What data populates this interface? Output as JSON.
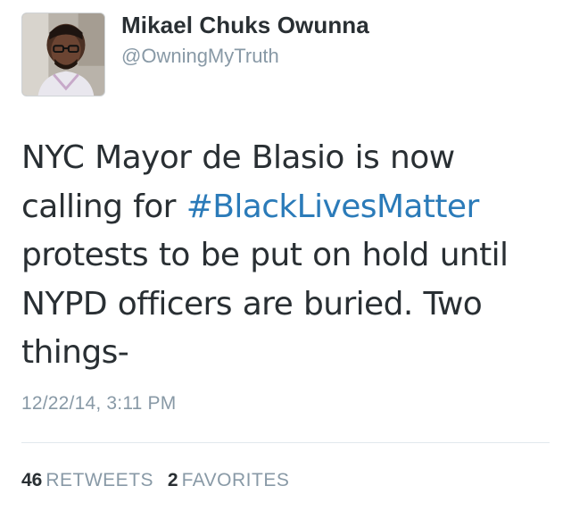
{
  "author": {
    "name": "Mikael Chuks Owunna",
    "handle": "@OwningMyTruth",
    "avatar_icon": "profile-photo"
  },
  "tweet": {
    "text_before": "NYC Mayor de Blasio is now calling for ",
    "hashtag": "#BlackLivesMatter",
    "text_after": " protests to be put on hold until NYPD officers are buried. Two things-",
    "timestamp": "12/22/14, 3:11 PM"
  },
  "stats": {
    "retweets_count": "46",
    "retweets_label": "RETWEETS",
    "favorites_count": "2",
    "favorites_label": "FAVORITES"
  },
  "colors": {
    "text": "#292f33",
    "muted": "#8899a6",
    "link": "#2b7bb9",
    "divider": "#e1e8ed"
  }
}
